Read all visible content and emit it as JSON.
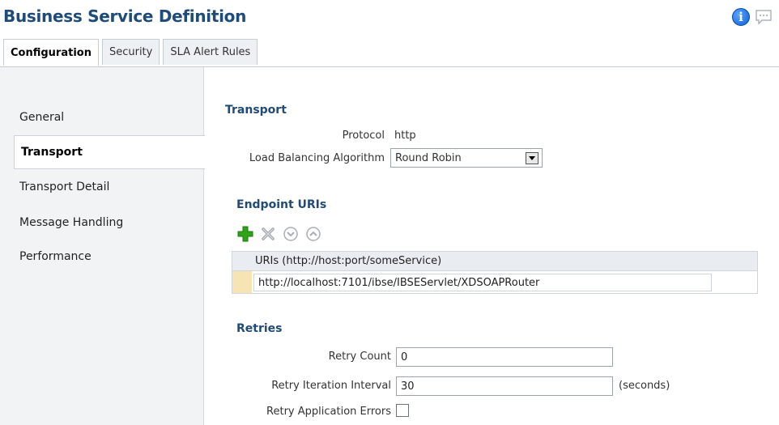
{
  "header": {
    "title": "Business Service Definition",
    "info_icon_glyph": "i",
    "icons": [
      "info-icon",
      "comment-icon"
    ]
  },
  "tabs": [
    {
      "label": "Configuration",
      "active": true
    },
    {
      "label": "Security",
      "active": false
    },
    {
      "label": "SLA Alert Rules",
      "active": false
    }
  ],
  "sidebar": {
    "items": [
      {
        "label": "General",
        "active": false
      },
      {
        "label": "Transport",
        "active": true
      },
      {
        "label": "Transport Detail",
        "active": false
      },
      {
        "label": "Message Handling",
        "active": false
      },
      {
        "label": "Performance",
        "active": false
      }
    ]
  },
  "transport": {
    "section_title": "Transport",
    "protocol_label": "Protocol",
    "protocol_value": "http",
    "lb_label": "Load Balancing Algorithm",
    "lb_value": "Round Robin"
  },
  "endpoints": {
    "section_title": "Endpoint URIs",
    "toolbar_icons": [
      "add-icon",
      "delete-icon",
      "move-down-icon",
      "move-up-icon"
    ],
    "column_header": "URIs (http://host:port/someService)",
    "rows": [
      "http://localhost:7101/ibse/IBSEServlet/XDSOAPRouter"
    ]
  },
  "retries": {
    "section_title": "Retries",
    "count_label": "Retry Count",
    "count_value": "0",
    "interval_label": "Retry Iteration Interval",
    "interval_value": "30",
    "interval_unit": "(seconds)",
    "app_errors_label": "Retry Application Errors",
    "app_errors_checked": false
  },
  "colors": {
    "title": "#1f4b78",
    "add_icon": "#2ea317",
    "info_icon": "#0b5fd6",
    "row_marker": "#f7e4b5"
  }
}
